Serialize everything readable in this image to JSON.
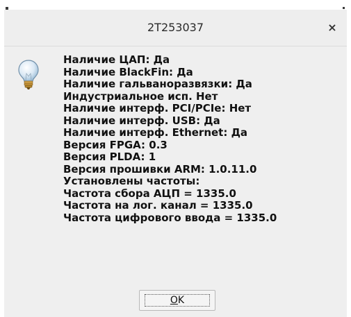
{
  "window": {
    "title": "2T253037",
    "close_symbol": "×"
  },
  "icon": {
    "name": "lightbulb-icon",
    "bulb_color": "#cfe3f2",
    "base_color": "#b88a2c"
  },
  "message": {
    "lines": [
      "Наличие ЦАП: Да",
      "Наличие BlackFin: Да",
      "Наличие гальваноразвязки: Да",
      "Индустриальное исп. Нет",
      "Наличие интерф. PCI/PCIe: Нет",
      "Наличие интерф. USB: Да",
      "Наличие интерф. Ethernet: Да",
      "Версия FPGA: 0.3",
      "Версия PLDA: 1",
      "Версия прошивки ARM: 1.0.11.0",
      "Установлены частоты:",
      "Частота сбора АЦП = 1335.0",
      "Частота на лог. канал = 1335.0",
      "Частота цифрового ввода = 1335.0"
    ]
  },
  "buttons": {
    "ok": {
      "mnemonic": "O",
      "rest": "K"
    }
  }
}
